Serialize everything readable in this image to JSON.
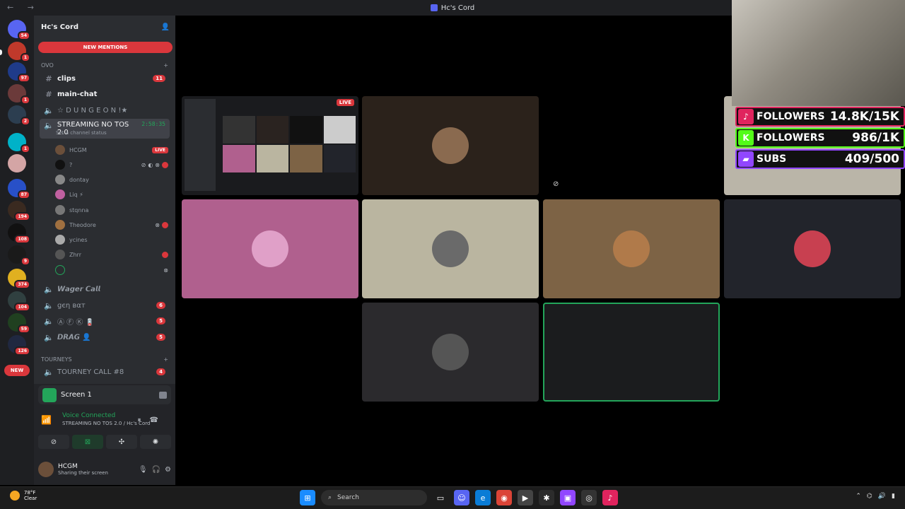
{
  "window": {
    "title": "Hc's Cord",
    "nav": "← →"
  },
  "servers": [
    {
      "badge": "54",
      "color": "#5865f2"
    },
    {
      "badge": "1",
      "color": "#c0392b"
    },
    {
      "badge": "97",
      "color": "#1f3b8a"
    },
    {
      "badge": "1",
      "color": "#6b3a3a"
    },
    {
      "badge": "2",
      "color": "#2c3e50"
    },
    {
      "badge": "1",
      "color": "#00b2c8"
    },
    {
      "badge": "",
      "color": "#d4a5a5"
    },
    {
      "badge": "87",
      "color": "#2850c8"
    },
    {
      "badge": "194",
      "color": "#3a2a20"
    },
    {
      "badge": "108",
      "color": "#111111"
    },
    {
      "badge": "9",
      "color": "#1a1a1a"
    },
    {
      "badge": "374",
      "color": "#e0b020"
    },
    {
      "badge": "104",
      "color": "#304040"
    },
    {
      "badge": "59",
      "color": "#204020"
    },
    {
      "badge": "126",
      "color": "#202840"
    }
  ],
  "new_pill": "NEW",
  "guild": {
    "name": "Hc's Cord",
    "new_mentions": "NEW MENTIONS"
  },
  "categories": {
    "ovo": "OVO",
    "tourneys": "TOURNEYS"
  },
  "channels": {
    "clips": {
      "name": "clips",
      "count": "11"
    },
    "main_chat": {
      "name": "main-chat"
    },
    "dungeon": {
      "name": "☆ D U N G E O N !★"
    },
    "streaming": {
      "name": "STREAMING NO TOS 2.0",
      "timer": "2:58:35",
      "status": "Set a channel status"
    },
    "wager": {
      "name": "𝙒𝙖𝙜𝙚𝙧 𝘾𝙖𝙡𝙡"
    },
    "gen": {
      "name": "ցєη вαт",
      "count": "6"
    },
    "afk": {
      "name": "Ⓐ Ⓕ Ⓚ 🪫",
      "count": "5"
    },
    "drag": {
      "name": "𝘿𝙍𝘼𝙂 👤",
      "count": "5"
    },
    "tourney": {
      "name": "TOURNEY CALL #8",
      "count": "4"
    }
  },
  "voice_users": [
    {
      "name": "HCGM",
      "live": "LIVE",
      "color": "#6b4f3a"
    },
    {
      "name": "?",
      "color": "#111111"
    },
    {
      "name": "dontay",
      "color": "#888888"
    },
    {
      "name": "Liq ⚡",
      "color": "#c060a0"
    },
    {
      "name": "stqnna",
      "color": "#777777"
    },
    {
      "name": "Theodore",
      "color": "#a07040"
    },
    {
      "name": "ycines",
      "color": "#aaaaaa"
    },
    {
      "name": "Zhrr",
      "color": "#555555"
    }
  ],
  "panel": {
    "screen": "Screen 1",
    "voice_title": "Voice Connected",
    "voice_sub": "STREAMING NO TOS 2.0 / Hc's Cord",
    "user_name": "HCGM",
    "user_status": "Sharing their screen"
  },
  "stage": {
    "live": "LIVE"
  },
  "overlay": {
    "rows": [
      {
        "label": "FOLLOWERS",
        "value": "14.8K/15K",
        "color": "#e0245e",
        "logo": "♪"
      },
      {
        "label": "FOLLOWERS",
        "value": "986/1K",
        "color": "#53fc18",
        "logo": "K"
      },
      {
        "label": "SUBS",
        "value": "409/500",
        "color": "#9146ff",
        "logo": "▰"
      }
    ]
  },
  "taskbar": {
    "temp": "78°F",
    "condition": "Clear",
    "search": "Search"
  }
}
